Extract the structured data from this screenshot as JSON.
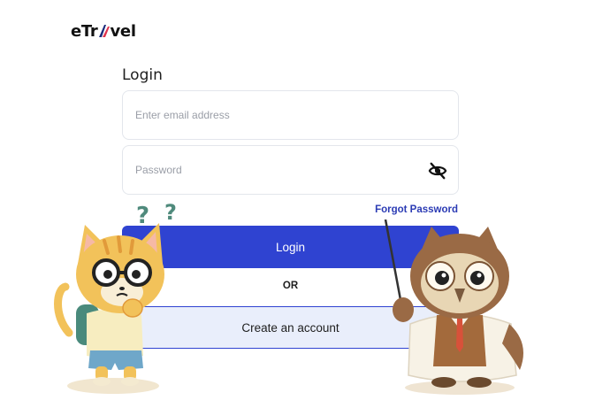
{
  "brand": {
    "logo_text_prefix": "eTr",
    "logo_text_suffix": "vel",
    "accent_color": "#2f43d1",
    "plane_colors": [
      "#1b2a7a",
      "#e0334d"
    ]
  },
  "login": {
    "title": "Login",
    "email_placeholder": "Enter email address",
    "password_placeholder": "Password",
    "forgot_password_label": "Forgot Password",
    "login_button_label": "Login",
    "divider_label": "OR",
    "create_account_label": "Create an account"
  },
  "icons": {
    "password_toggle": "eye-slash-icon"
  },
  "illustrations": {
    "left": "confused-cat-mascot",
    "right": "owl-teacher-mascot"
  }
}
